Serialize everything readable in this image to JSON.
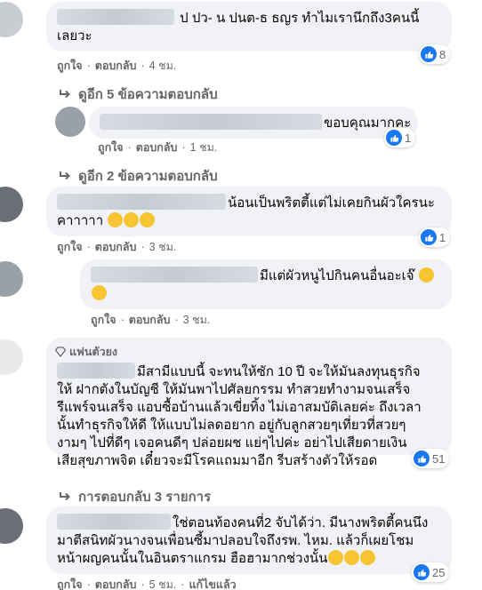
{
  "comments": [
    {
      "id": "c1",
      "text_lines": [
        "ป ปว- น ปนต-ธ ธญร ทำไมเรานึกถึง3คนนี้",
        "เลยวะ"
      ],
      "actions": {
        "like": "ถูกใจ",
        "reply": "ตอบกลับ",
        "time": "4 ชม."
      },
      "reactions": "8",
      "more_replies": "ดูอีก 5 ข้อความตอบกลับ"
    },
    {
      "id": "c2",
      "text_lines": [
        "ขอบคุณมากคะ"
      ],
      "actions": {
        "like": "ถูกใจ",
        "reply": "ตอบกลับ",
        "time": "1 ชม."
      },
      "reactions": "1",
      "more_replies": "ดูอีก 2 ข้อความตอบกลับ"
    },
    {
      "id": "c3",
      "text_lines": [
        "น้อนเป็นพริตตี้แต่ไม่เคยกินผัวใครนะ",
        "คาาาาา"
      ],
      "actions": {
        "like": "ถูกใจ",
        "reply": "ตอบกลับ",
        "time": "3 ชม."
      },
      "reactions": "1"
    },
    {
      "id": "c4",
      "text_lines": [
        "มีแต่ผัวหนูไปกินคนอื่นอะเจ๊"
      ],
      "actions": {
        "like": "ถูกใจ",
        "reply": "ตอบกลับ",
        "time": "3 ชม."
      }
    },
    {
      "id": "c5",
      "badge": "แฟนตัวยง",
      "text_lines": [
        "มีสามีแบบนี้ จะทนให้ซัก 10 ปี จะให้มันลงทุนธุรกิจ",
        "ให้ ฝากตังในบัญชี ให้มันพาไปศัลยกรรม ทำสวยทำงามจนเสร็จ",
        "รีแพร์จนเสร็จ แอบซื้อบ้านแล้วเขี่ยทิ้ง ไม่เอาสมบัติเลยค่ะ ถึงเวลา",
        "นั้นทำธุรกิจให้ดี ให้แบบไม่ลดอยาก อยู่กับลูกสวยๆเที่ยวที่สวยๆ",
        "งามๆ ไปที่ดีๆ เจอคนดีๆ ปล่อยผช แย่ๆไปค่ะ อย่าไปเสียดายเงิน",
        "เสียสุขภาพจิต เดี๋ยวจะมีโรคแถมมาอีก รีบสร้างตัวให้รอด"
      ],
      "reactions": "51",
      "more_replies": "การตอบกลับ 3 รายการ"
    },
    {
      "id": "c6",
      "text_lines": [
        "ใช่ตอนท้องคนที่2 จับได้ว่า. มีนางพริตตี้คนนึง",
        "มาตีสนิทผัวนางจนเพื่อนซี้มาปลอบใจถึงรพ. ไหม. แล้วก็เผยโชม",
        "หน้าผญคนนั้นในอินตราแกรม ฮือฮามากช่วงนั้น"
      ],
      "actions": {
        "like": "ถูกใจ",
        "reply": "ตอบกลับ",
        "time": "5 ชม.",
        "edited": "แก้ไขแล้ว"
      },
      "reactions": "25"
    }
  ],
  "colors": {
    "bubble": "#f0f2f5",
    "meta": "#65676b",
    "like": "#1877f2"
  }
}
